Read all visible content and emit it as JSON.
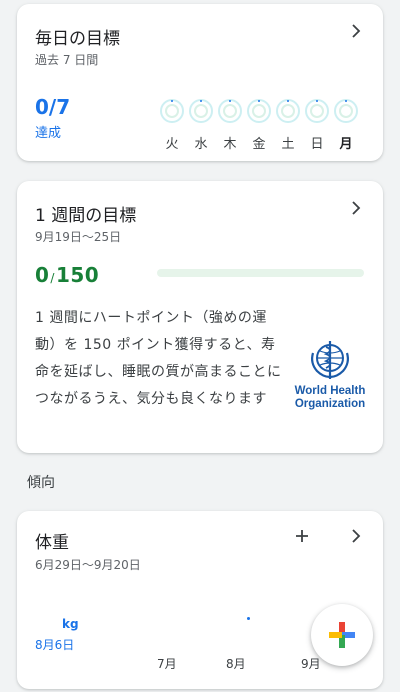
{
  "daily_goal": {
    "title": "毎日の目標",
    "subtitle": "過去 7 日間",
    "value": "0/7",
    "value_label": "達成",
    "days": [
      "火",
      "水",
      "木",
      "金",
      "土",
      "日",
      "月"
    ],
    "today": "月",
    "achieved_days": 0,
    "total_days": 7
  },
  "weekly_goal": {
    "title": "1 週間の目標",
    "date_range": "9月19日～25日",
    "current": "0",
    "separator": "/",
    "target": "150",
    "progress_fraction": 0.0,
    "description": "1 週間にハートポイント（強めの運動）を 150 ポイント獲得すると、寿命を延ばし、睡眠の質が高まることにつながるうえ、気分も良くなります",
    "logo_text_line1": "World Health",
    "logo_text_line2": "Organization"
  },
  "trends": {
    "section_label": "傾向"
  },
  "weight": {
    "title": "体重",
    "date_range": "6月29日～9月20日",
    "unit": "kg",
    "selected_date": "8月6日",
    "months": [
      "7月",
      "8月",
      "9月"
    ]
  },
  "colors": {
    "accent_blue": "#1a73e8",
    "accent_green": "#188038",
    "ring_cyan": "#cdeff2",
    "ring_green": "#d9f1e7"
  },
  "icons": {
    "chevron": "chevron-right-icon",
    "add": "plus-icon",
    "fab": "google-fit-plus-icon"
  }
}
